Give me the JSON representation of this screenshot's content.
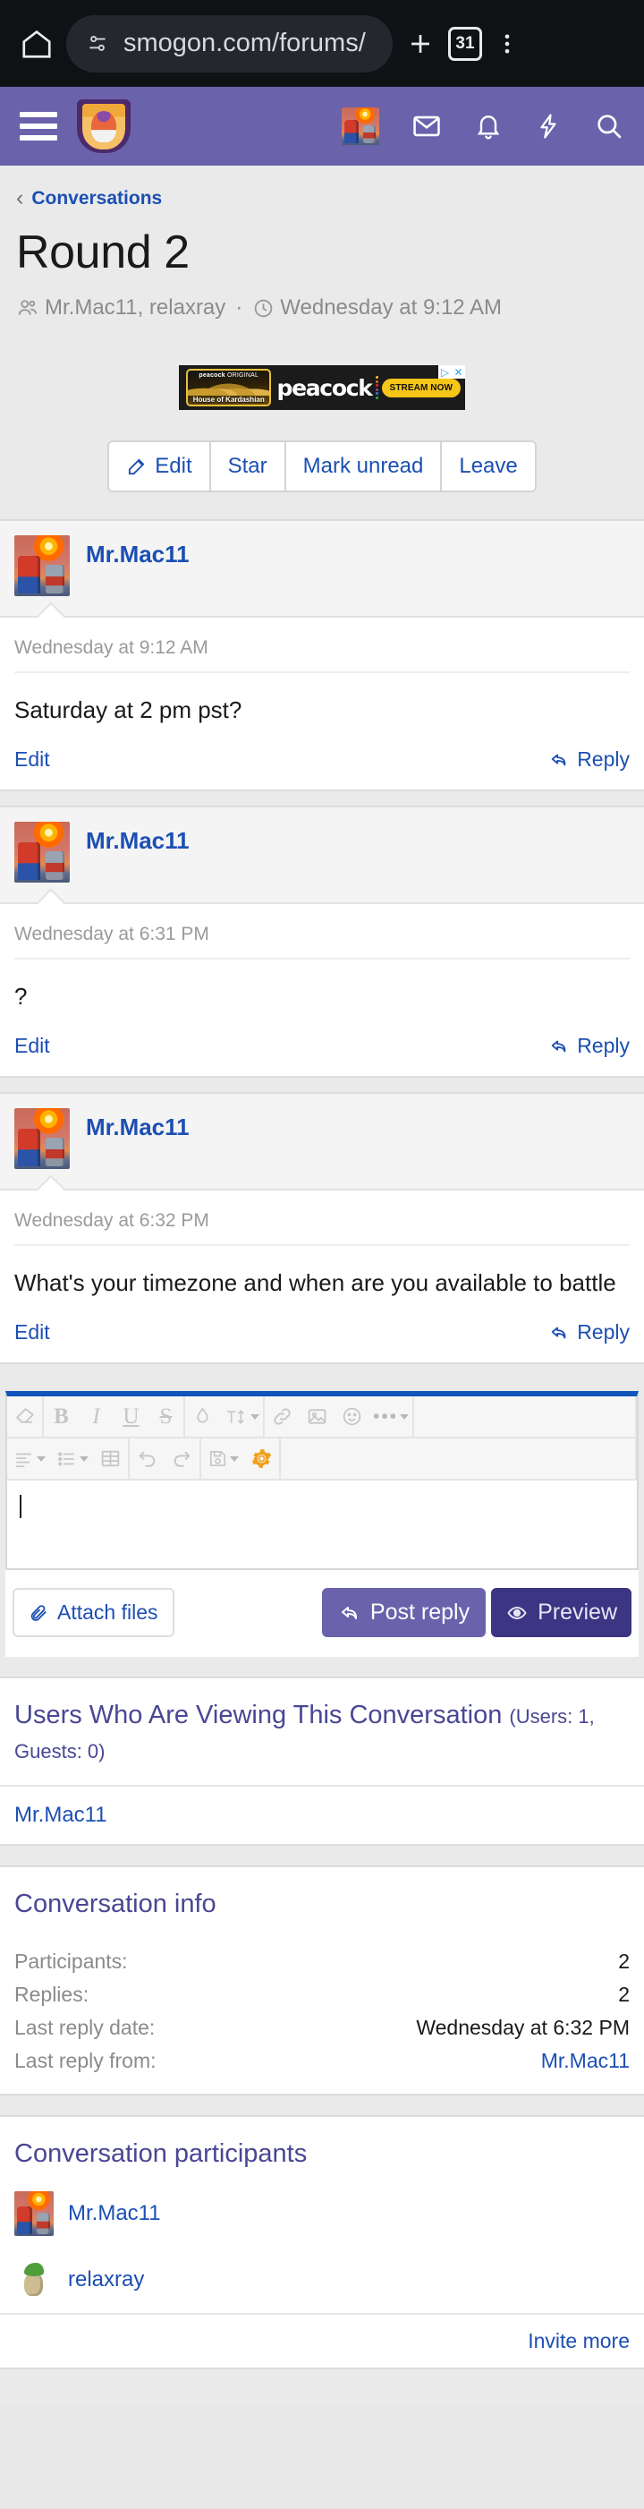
{
  "browser": {
    "home_icon": "home-icon",
    "site_info_icon": "site-settings-icon",
    "url": "smogon.com/forums/",
    "new_tab_icon": "plus-icon",
    "tab_count": "31",
    "menu_icon": "three-dot-menu-icon"
  },
  "site_header": {
    "menu_icon": "hamburger-menu-icon",
    "logo": "smogon-shield-logo",
    "avatar": "user-avatar",
    "inbox_icon": "envelope-icon",
    "alerts_icon": "bell-icon",
    "bolt_icon": "lightning-bolt-icon",
    "search_icon": "magnifier-icon"
  },
  "breadcrumb": {
    "chevron": "‹",
    "label": "Conversations"
  },
  "conversation": {
    "title": "Round 2",
    "participants_text": "Mr.Mac11, relaxray",
    "separator": "·",
    "started_at": "Wednesday at 9:12 AM"
  },
  "ad": {
    "poster_top_brand": "peacock",
    "poster_top_label": "ORIGINAL",
    "poster_title": "House of Kardashian",
    "brand": "peacock",
    "cta": "STREAM NOW",
    "adchoices_icon": "adchoices-icon",
    "close_icon": "close-icon",
    "dot_colors": [
      "#f5c518",
      "#f26522",
      "#e4262c",
      "#8b46a8",
      "#2a7de1",
      "#2aa84a"
    ]
  },
  "actions": [
    {
      "label": "Edit",
      "icon": "edit-pencil-icon"
    },
    {
      "label": "Star",
      "icon": ""
    },
    {
      "label": "Mark unread",
      "icon": ""
    },
    {
      "label": "Leave",
      "icon": ""
    }
  ],
  "messages": [
    {
      "author": "Mr.Mac11",
      "avatar": "transformers-avatar",
      "date": "Wednesday at 9:12 AM",
      "text": "Saturday at 2 pm pst?",
      "edit_label": "Edit",
      "reply_label": "Reply"
    },
    {
      "author": "Mr.Mac11",
      "avatar": "transformers-avatar",
      "date": "Wednesday at 6:31 PM",
      "text": "?",
      "edit_label": "Edit",
      "reply_label": "Reply"
    },
    {
      "author": "Mr.Mac11",
      "avatar": "transformers-avatar",
      "date": "Wednesday at 6:32 PM",
      "text": "What's your timezone and when are you available to battle",
      "edit_label": "Edit",
      "reply_label": "Reply"
    }
  ],
  "editor": {
    "toolbar_row1": [
      {
        "name": "remove-formatting-icon",
        "glyph": "eraser"
      },
      {
        "name": "bold-icon",
        "glyph": "B"
      },
      {
        "name": "italic-icon",
        "glyph": "I"
      },
      {
        "name": "underline-icon",
        "glyph": "U"
      },
      {
        "name": "strikethrough-icon",
        "glyph": "S"
      },
      {
        "name": "text-color-icon",
        "glyph": "droplet"
      },
      {
        "name": "font-size-icon",
        "glyph": "T-size"
      },
      {
        "name": "insert-link-icon",
        "glyph": "link"
      },
      {
        "name": "insert-image-icon",
        "glyph": "image"
      },
      {
        "name": "emoji-icon",
        "glyph": "smiley"
      },
      {
        "name": "more-options-icon",
        "glyph": "ellipsis"
      }
    ],
    "toolbar_row2": [
      {
        "name": "text-align-icon",
        "glyph": "align"
      },
      {
        "name": "list-icon",
        "glyph": "list"
      },
      {
        "name": "insert-table-icon",
        "glyph": "table"
      },
      {
        "name": "undo-icon",
        "glyph": "undo"
      },
      {
        "name": "redo-icon",
        "glyph": "redo"
      },
      {
        "name": "draft-icon",
        "glyph": "save"
      },
      {
        "name": "editor-settings-icon",
        "glyph": "gear"
      }
    ],
    "content": "",
    "attach_label": "Attach files",
    "attach_icon": "paperclip-icon",
    "post_label": "Post reply",
    "post_icon": "reply-arrow-icon",
    "preview_label": "Preview",
    "preview_icon": "eye-icon",
    "accent_color": "#1155bb",
    "post_button_color": "#6a62ab",
    "preview_button_color": "#3b3584"
  },
  "viewers": {
    "title": "Users Who Are Viewing This Conversation",
    "counts": "(Users: 1, Guests: 0)",
    "users": [
      "Mr.Mac11"
    ]
  },
  "info": {
    "title": "Conversation info",
    "rows": [
      {
        "label": "Participants:",
        "value": "2",
        "linked": false
      },
      {
        "label": "Replies:",
        "value": "2",
        "linked": false
      },
      {
        "label": "Last reply date:",
        "value": "Wednesday at 6:32 PM",
        "linked": false
      },
      {
        "label": "Last reply from:",
        "value": "Mr.Mac11",
        "linked": true
      }
    ]
  },
  "participants_block": {
    "title": "Conversation participants",
    "people": [
      {
        "name": "Mr.Mac11",
        "avatar": "transformers-avatar"
      },
      {
        "name": "relaxray",
        "avatar": "pokemon-avatar"
      }
    ],
    "invite_label": "Invite more"
  }
}
